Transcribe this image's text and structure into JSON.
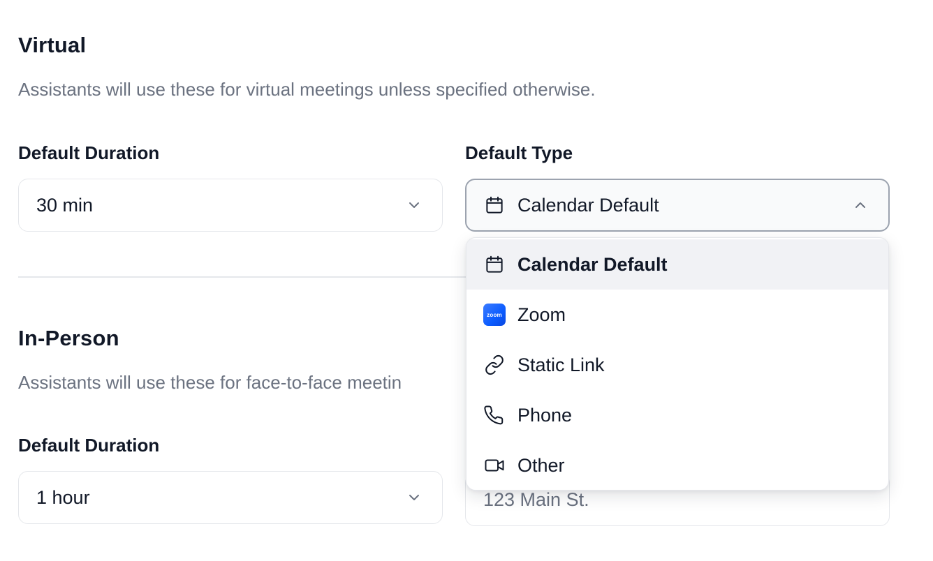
{
  "virtual": {
    "title": "Virtual",
    "description": "Assistants will use these for virtual meetings unless specified otherwise.",
    "duration_label": "Default Duration",
    "duration_value": "30 min",
    "type_label": "Default Type",
    "type_value": "Calendar Default"
  },
  "in_person": {
    "title": "In-Person",
    "description": "Assistants will use these for face-to-face meetin",
    "duration_label": "Default Duration",
    "duration_value": "1 hour",
    "location_placeholder": "123 Main St."
  },
  "dropdown": {
    "options": [
      {
        "label": "Calendar Default",
        "icon": "calendar-icon",
        "selected": true
      },
      {
        "label": "Zoom",
        "icon": "zoom-logo-icon",
        "selected": false
      },
      {
        "label": "Static Link",
        "icon": "link-icon",
        "selected": false
      },
      {
        "label": "Phone",
        "icon": "phone-icon",
        "selected": false
      },
      {
        "label": "Other",
        "icon": "video-camera-icon",
        "selected": false
      }
    ],
    "zoom_logo_text": "zoom"
  },
  "colors": {
    "text_primary": "#111827",
    "text_secondary": "#6b7280",
    "border": "#e5e7eb",
    "selected_bg": "#f1f2f5",
    "zoom_blue": "#0b5cff"
  }
}
